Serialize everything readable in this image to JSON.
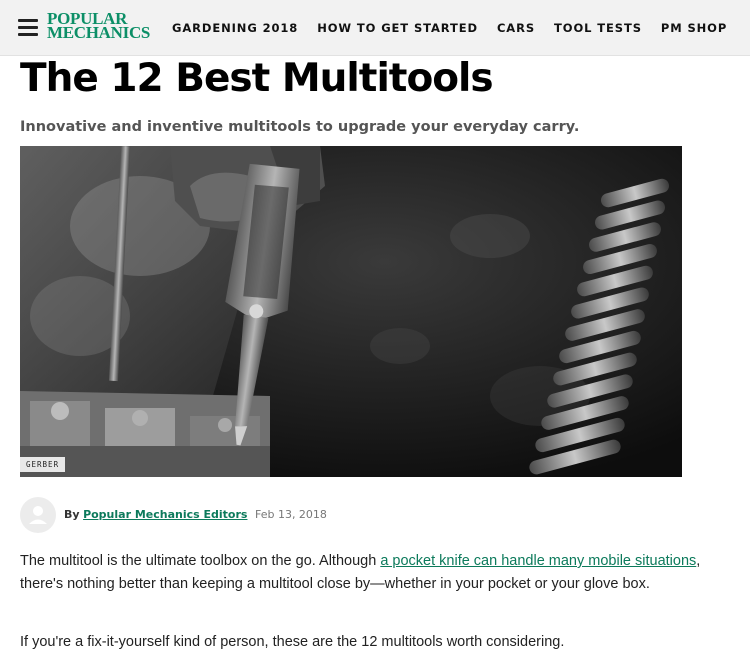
{
  "header": {
    "logo_line1": "POPULAR",
    "logo_line2": "MECHANICS",
    "nav": [
      "GARDENING 2018",
      "HOW TO GET STARTED",
      "CARS",
      "TOOL TESTS",
      "PM SHOP"
    ],
    "brand_color": "#0c8f67"
  },
  "article": {
    "title": "The 12 Best Multitools",
    "dek": "Innovative and inventive multitools to upgrade your everyday carry.",
    "image_credit": "GERBER",
    "byline": {
      "by": "By",
      "author": "Popular Mechanics Editors",
      "date": "Feb 13, 2018"
    },
    "paragraph1": {
      "before": "The multitool is the ultimate toolbox on the go. Although ",
      "link": "a pocket knife can handle many mobile situations",
      "after": ", there's nothing better than keeping a multitool close by—whether in your pocket or your glove box."
    },
    "paragraph2": "If you're a fix-it-yourself kind of person, these are the 12 multitools worth considering."
  },
  "icons": {
    "menu": "hamburger-menu-icon",
    "avatar": "user-avatar-icon"
  }
}
